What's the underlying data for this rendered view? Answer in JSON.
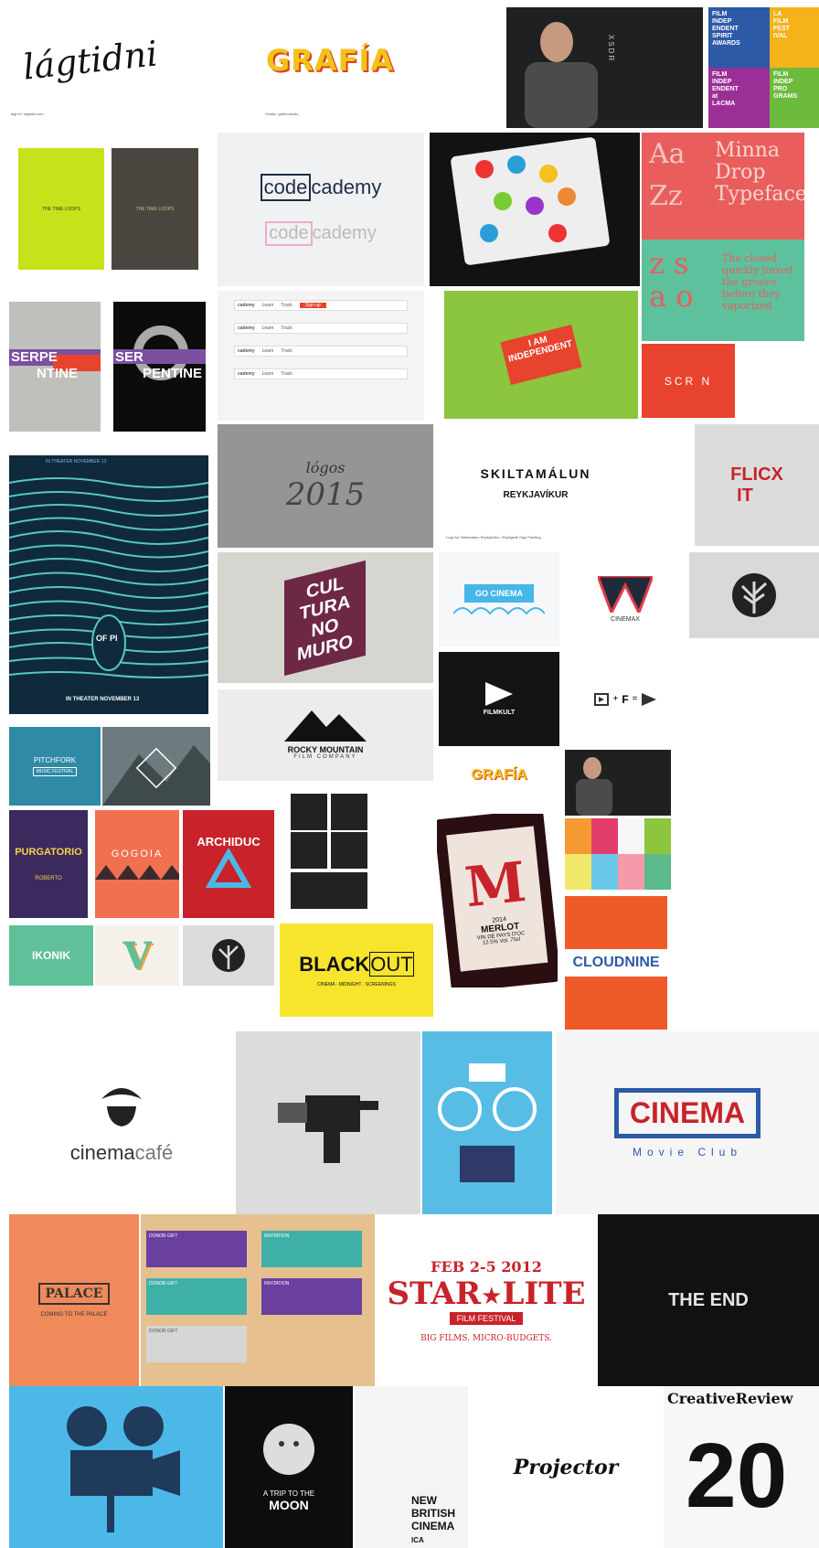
{
  "tiles": {
    "lagtidni": {
      "text": "lágtidni",
      "caption": "lagt fn / lagtidni.com"
    },
    "grafia": {
      "text": "GRAFÍA",
      "caption": "Grafía / grafia.studio"
    },
    "portrait1": {
      "text": "XSDR"
    },
    "spirit": {
      "t1": "FILM INDEP ENDENT SPIRIT AWARDS",
      "t2": "LA FILM FEST IVAL",
      "t3": "FILM INDEP ENDENT at LACMA",
      "t4": "FILM INDEP PRO GRAMS"
    },
    "books": {
      "title": "THE TIME LOOPS"
    },
    "codecademy": {
      "code": "code",
      "cademy": "cademy"
    },
    "aazz": {
      "aa": "Aa",
      "zz": "Zz",
      "minna": "Minna Drop Typeface",
      "zsao": "z s a o",
      "para": "The closed quickly jinxed the groove before they vaporized"
    },
    "serpentine": {
      "ser": "SER",
      "pentine": "PENTINE",
      "ser2": "SERPE",
      "ntine": "NTINE"
    },
    "codeRows": {
      "name": "cademy",
      "learn": "Learn",
      "track": "Track",
      "signup": "Sign up"
    },
    "independent": {
      "text": "I AM INDEPENDENT"
    },
    "screen": {
      "text": "SCR N"
    },
    "waves": {
      "header": "IN THEATER NOVEMBER 13",
      "badge": "OF PI",
      "footer": "IN THEATER NOVEMBER 13"
    },
    "logos": {
      "title": "lógos",
      "year": "2015"
    },
    "skilta": {
      "line1": "SKILTAMÁLUN",
      "line2": "REYKJAVÍKUR",
      "caption": "Logo for Skiltamálun Reykjavíkur / Reykjavik Sign Painting"
    },
    "flicx": {
      "l1": "FLICX",
      "l2": "IT"
    },
    "cultura": {
      "l1": "CUL",
      "l2": "TURA",
      "l3": "NO",
      "l4": "MURO"
    },
    "gocinema": {
      "text": "GO CINEMA"
    },
    "cinemax": {
      "text": "CINEMAX"
    },
    "filmkult": {
      "text": "FILMKULT"
    },
    "formula": {
      "plus": "+",
      "f": "F",
      "eq": "="
    },
    "rocky": {
      "l1": "ROCKY MOUNTAIN",
      "l2": "FILM COMPANY"
    },
    "pitchfork": {
      "text": "PITCHFORK",
      "sub": "MUSIC FESTIVAL"
    },
    "grafia2": {
      "text": "GRAFÍA"
    },
    "merlot": {
      "letter": "M",
      "year": "2014",
      "name": "MERLOT",
      "sub": "VIN DE PAYS D'OC",
      "abv": "12.5% Vol. 75cl"
    },
    "purgatorio": {
      "text": "PURGATORIO",
      "sub": "ROBERTO"
    },
    "gogola": {
      "text": "GOGOIA"
    },
    "archiduc": {
      "text": "ARCHIDUC"
    },
    "cloudnine": {
      "l1": "CLOUD",
      "l2": "NINE"
    },
    "ikonik": {
      "text": "IKONIK"
    },
    "vtile": {
      "text": "V"
    },
    "blackout": {
      "t1": "BLACK",
      "t2": "OUT",
      "sub": "CINEMA · MIDNIGHT · SCREENINGS"
    },
    "cinemacafe": {
      "a": "cinema",
      "b": "café"
    },
    "cinemaclub": {
      "title": "CINEMA",
      "sub": "Movie Club"
    },
    "palace": {
      "text": "PALACE",
      "sub": "COMING TO THE PALACE"
    },
    "cards": {
      "inv": "INVITATION",
      "gift": "DONOR GIFT"
    },
    "starlite": {
      "date": "FEB 2-5 2012",
      "star": "STAR",
      "lite": "LITE",
      "ribbon": "FILM FESTIVAL",
      "sub": "BIG FILMS. MICRO-BUDGETS."
    },
    "theend": {
      "text": "THE END"
    },
    "moon": {
      "a": "A TRIP TO THE",
      "b": "MOON"
    },
    "nbc": {
      "l1": "NEW",
      "l2": "BRITISH",
      "l3": "CINEMA",
      "ica": "ICA"
    },
    "projector": {
      "text": "Projector"
    },
    "creative": {
      "text": "CreativeReview",
      "num": "20"
    }
  }
}
